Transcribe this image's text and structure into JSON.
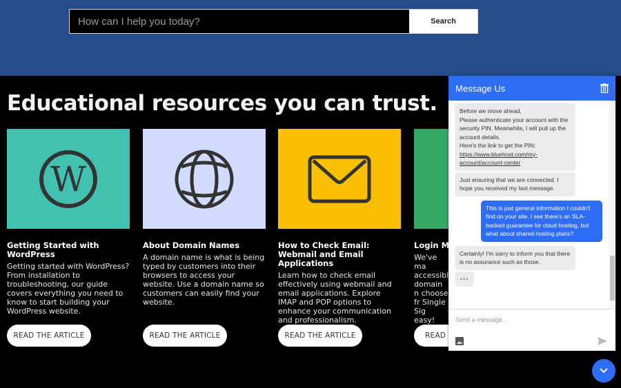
{
  "search": {
    "placeholder": "How can I help you today?",
    "button_label": "Search"
  },
  "section": {
    "title": "Educational resources you can trust."
  },
  "cards": [
    {
      "icon": "wordpress-icon",
      "color": "#42c1b1",
      "title": "Getting Started with WordPress",
      "description": "Getting started with WordPress? From installation to troubleshooting, our guide covers everything you need to know to start building your WordPress website.",
      "button_label": "READ THE ARTICLE"
    },
    {
      "icon": "globe-icon",
      "color": "#d1dcff",
      "title": "About Domain Names",
      "description": "A domain name is what is being typed by customers into their browsers to access your website. Use a domain name so customers can easily find your website.",
      "button_label": "READ THE ARTICLE"
    },
    {
      "icon": "envelope-icon",
      "color": "#f8c000",
      "title": "How to Check Email: Webmail and Email Applications",
      "description": "Learn how to check email effectively using webmail and email applications. Explore IMAP and POP options to enhance your communication and professionalism.",
      "button_label": "READ THE ARTICLE"
    },
    {
      "icon": "login-icon",
      "color": "#34a865",
      "title": "Login Ma",
      "description": "We've ma accessibl domain n choose fr Single Sig easy!",
      "button_label": "READ T"
    }
  ],
  "chat": {
    "title": "Message Us",
    "messages": [
      {
        "from": "agent",
        "lines": [
          "Before we move ahead,",
          "Please authenticate your account with the security PIN. Meanwhile, I will pull up the account details.",
          "Here's the link to get the PIN:"
        ],
        "link": "https://www.bluehost.com/my-account/account-center"
      },
      {
        "from": "agent",
        "text": "Just ensuring that we are connected. I hope you received my last message."
      },
      {
        "from": "user",
        "text": "This is just general information I couldn't find on your site. I see there's an SLA-backed guarantee for cloud hosting, but what about shared hosting plans?"
      },
      {
        "from": "agent",
        "text": "Certainly! I'm sorry to inform you that there is no assurance such as those."
      },
      {
        "from": "agent",
        "typing": "•••"
      }
    ],
    "input_placeholder": "Send a message..."
  }
}
